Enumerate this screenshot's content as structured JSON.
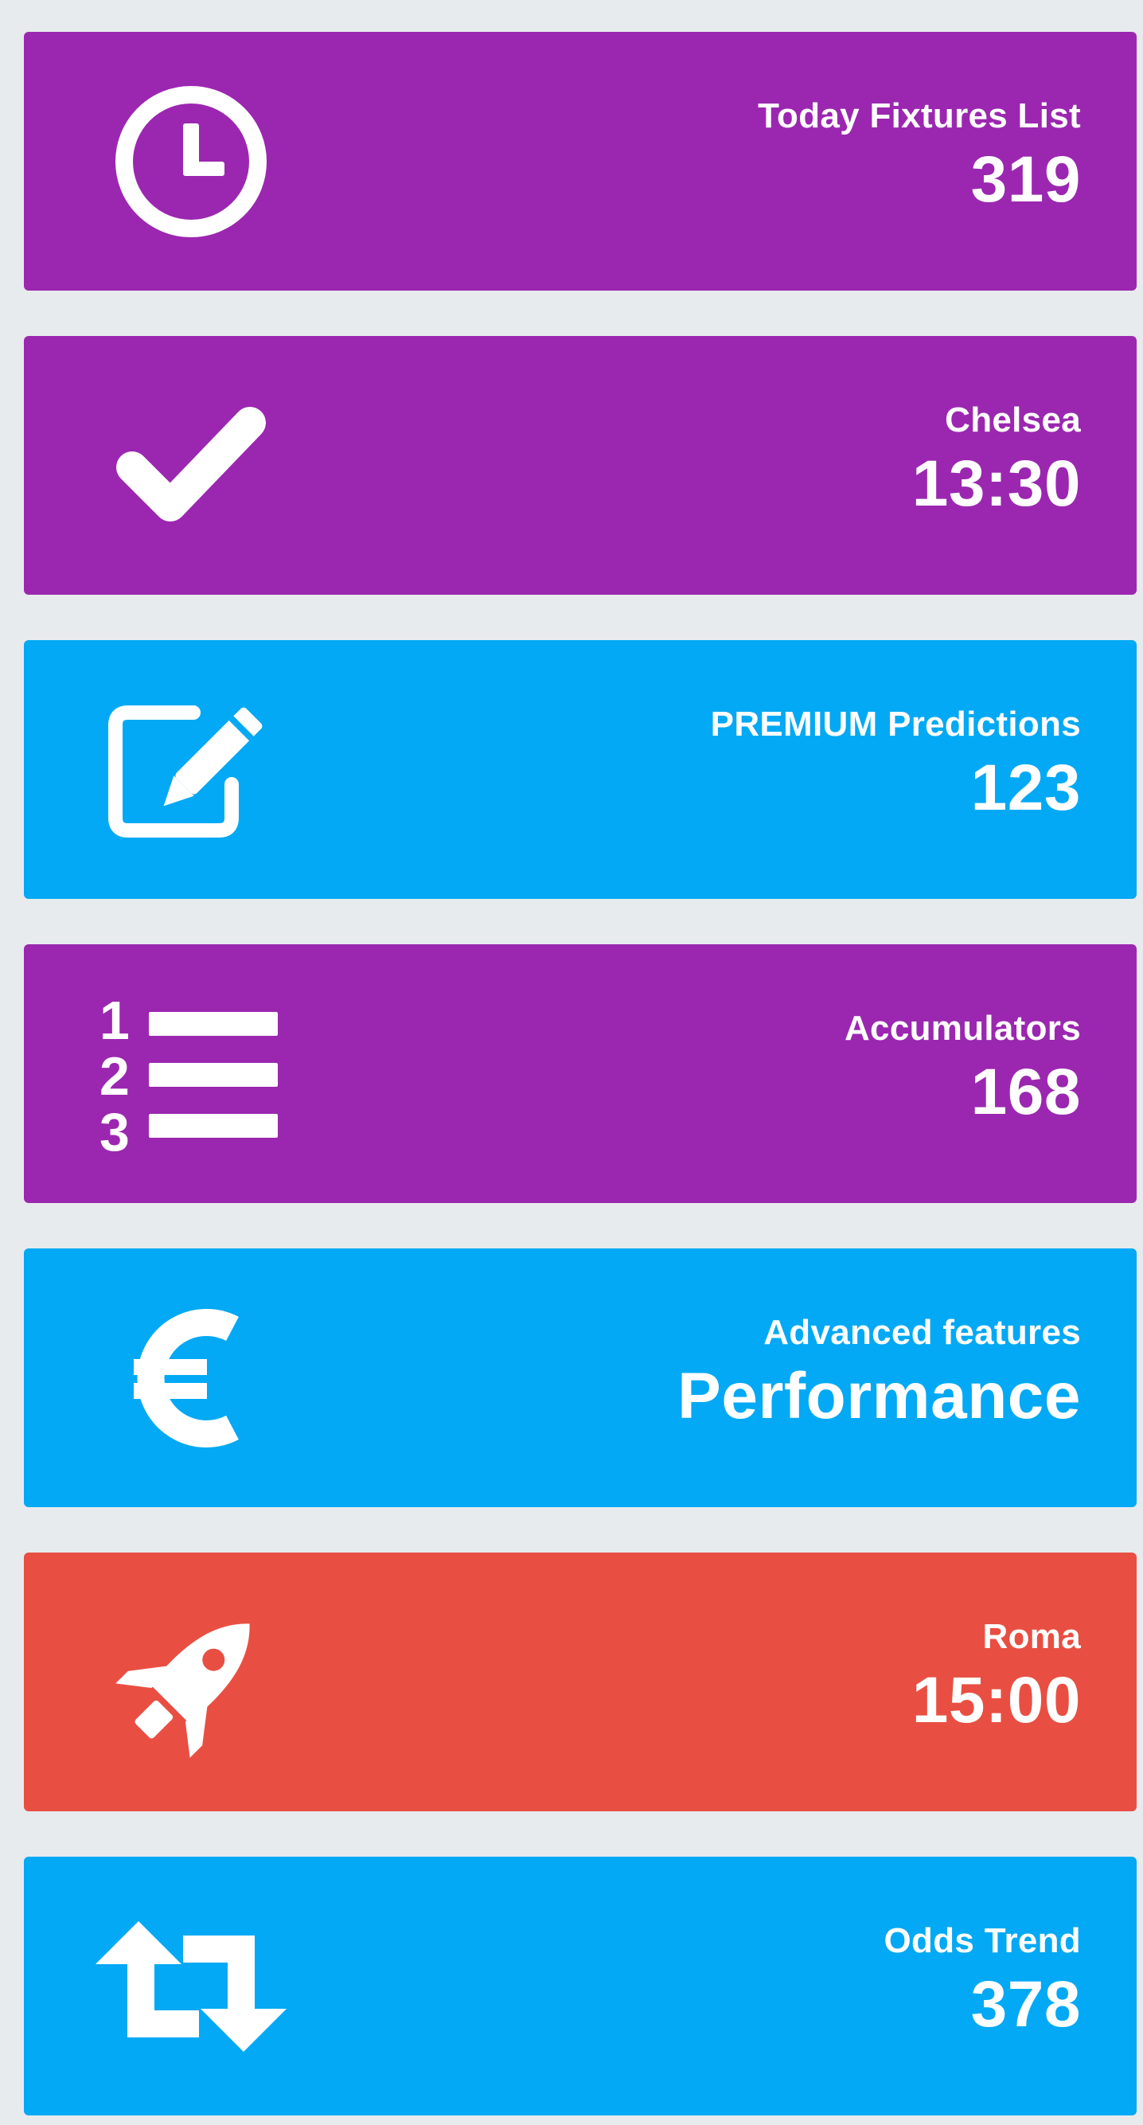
{
  "colors": {
    "purple": "#9b27b0",
    "blue": "#03a9f4",
    "red": "#e84f42",
    "background": "#e7ebee"
  },
  "tiles": [
    {
      "label": "Today Fixtures List",
      "value": "319",
      "icon": "clock-icon",
      "color": "#9b27b0"
    },
    {
      "label": "Chelsea",
      "value": "13:30",
      "icon": "check-icon",
      "color": "#9b27b0"
    },
    {
      "label": "PREMIUM Predictions",
      "value": "123",
      "icon": "edit-icon",
      "color": "#03a9f4"
    },
    {
      "label": "Accumulators",
      "value": "168",
      "icon": "numbered-list-icon",
      "color": "#9b27b0"
    },
    {
      "label": "Advanced features",
      "value": "Performance",
      "icon": "euro-icon",
      "color": "#03a9f4"
    },
    {
      "label": "Roma",
      "value": "15:00",
      "icon": "rocket-icon",
      "color": "#e84f42"
    },
    {
      "label": "Odds Trend",
      "value": "378",
      "icon": "retweet-icon",
      "color": "#03a9f4"
    }
  ]
}
